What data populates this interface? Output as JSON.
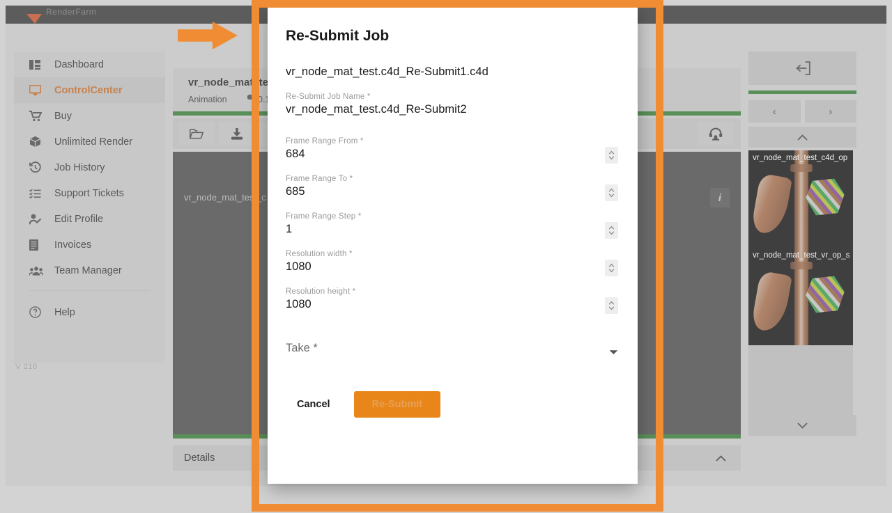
{
  "topbar": {
    "brand": "RenderFarm",
    "logo_icon": "triangle-logo-icon"
  },
  "sidebar": {
    "version": "V 210",
    "items": [
      {
        "label": "Dashboard",
        "icon": "dashboard-icon",
        "active": false
      },
      {
        "label": "ControlCenter",
        "icon": "monitor-icon",
        "active": true
      },
      {
        "label": "Buy",
        "icon": "cart-icon",
        "active": false
      },
      {
        "label": "Unlimited Render",
        "icon": "box-icon",
        "active": false
      },
      {
        "label": "Job History",
        "icon": "history-icon",
        "active": false
      },
      {
        "label": "Support Tickets",
        "icon": "list-icon",
        "active": false
      },
      {
        "label": "Edit Profile",
        "icon": "user-edit-icon",
        "active": false
      },
      {
        "label": "Invoices",
        "icon": "invoice-icon",
        "active": false
      },
      {
        "label": "Team Manager",
        "icon": "team-icon",
        "active": false
      }
    ],
    "help": {
      "label": "Help",
      "icon": "help-circle-icon"
    }
  },
  "main": {
    "job_title": "vr_node_mat_te",
    "job_type": "Animation",
    "job_cost": "0.1",
    "canvas_file": "vr_node_mat_test_c",
    "info_badge": "i",
    "details_label": "Details",
    "toolbar": [
      {
        "icon": "folder-icon"
      },
      {
        "icon": "download-icon"
      },
      {
        "icon": "copy-icon"
      }
    ],
    "support_icon": "headset-icon",
    "collapse_icon": "chevron-up-icon"
  },
  "rail": {
    "export_icon": "import-box-icon",
    "prev_label": "‹",
    "next_label": "›",
    "scroll_up_icon": "chevron-up-icon",
    "scroll_down_icon": "chevron-down-icon",
    "thumbnails": [
      {
        "label": "vr_node_mat_test_c4d_op"
      },
      {
        "label": "vr_node_mat_test_vr_op_s"
      }
    ]
  },
  "modal": {
    "title": "Re-Submit Job",
    "job_file": "vr_node_mat_test.c4d_Re-Submit1.c4d",
    "fields": [
      {
        "label": "Re-Submit Job Name *",
        "value": "vr_node_mat_test.c4d_Re-Submit2",
        "stepper": false
      },
      {
        "label": "Frame Range From *",
        "value": "684",
        "stepper": true
      },
      {
        "label": "Frame Range To *",
        "value": "685",
        "stepper": true
      },
      {
        "label": "Frame Range Step *",
        "value": "1",
        "stepper": true
      },
      {
        "label": "Resolution width *",
        "value": "1080",
        "stepper": true
      },
      {
        "label": "Resolution height *",
        "value": "1080",
        "stepper": true
      }
    ],
    "take": {
      "label": "Take *",
      "value": "",
      "caret_icon": "chevron-down-icon"
    },
    "cancel_label": "Cancel",
    "submit_label": "Re-Submit"
  },
  "annotations": {
    "arrow": "orange-arrow-annotation",
    "rect": "orange-rectangle-annotation"
  },
  "colors": {
    "accent": "#e8741a",
    "submit": "#e8861a",
    "annotation": "#f08c33",
    "progress": "#2e8b2e"
  }
}
